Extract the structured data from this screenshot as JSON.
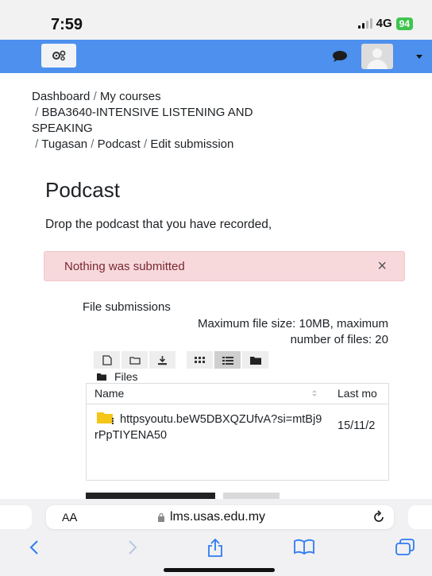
{
  "status_bar": {
    "time": "7:59",
    "network": "4G",
    "battery": "94"
  },
  "breadcrumb": [
    {
      "label": "Dashboard",
      "sep": ""
    },
    {
      "label": "My courses",
      "sep": "/"
    },
    {
      "label": "BBA3640-INTENSIVE LISTENING AND",
      "sep": "/"
    },
    {
      "label": "SPEAKING",
      "sep": ""
    },
    {
      "label": "Tugasan",
      "sep": "/"
    },
    {
      "label": "Podcast",
      "sep": "/"
    },
    {
      "label": "Edit submission",
      "sep": "/"
    }
  ],
  "page": {
    "title": "Podcast",
    "intro": "Drop the podcast that you have recorded,"
  },
  "alert": {
    "message": "Nothing was submitted",
    "close": "×"
  },
  "file_submissions": {
    "label": "File submissions",
    "limits_line1": "Maximum file size: 10MB, maximum",
    "limits_line2": "number of files: 20",
    "folder_label": "Files",
    "columns": {
      "name": "Name",
      "last_modified": "Last mo"
    },
    "files": [
      {
        "name": "httpsyoutu.beW5DBXQZUfvA?si=mtBj9rPpTIYENA50",
        "date": "15/11/2"
      }
    ]
  },
  "browser": {
    "aa_small": "A",
    "aa_big": "A",
    "url": "lms.usas.edu.my"
  },
  "colors": {
    "navbar": "#4d90ee",
    "alert_bg": "#f7d9dc",
    "alert_text": "#7a2832",
    "battery": "#3fc44e"
  }
}
